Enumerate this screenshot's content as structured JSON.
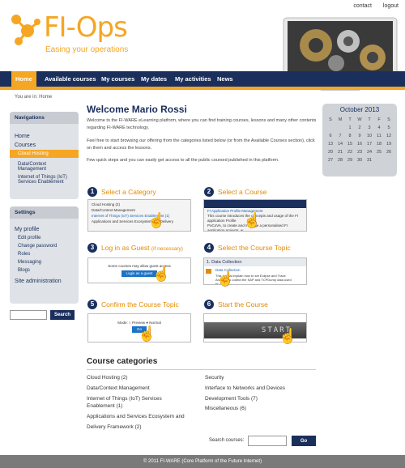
{
  "toplinks": {
    "contact": "contact",
    "logout": "logout"
  },
  "logo": {
    "title": "FI-Ops",
    "subtitle": "Easing your operations"
  },
  "nav": [
    {
      "label": "Home",
      "active": true
    },
    {
      "label": "Available courses"
    },
    {
      "label": "My courses"
    },
    {
      "label": "My dates"
    },
    {
      "label": "My activities"
    },
    {
      "label": "News"
    }
  ],
  "breadcrumb": "You are in: Home",
  "navigations": {
    "title": "Navigations",
    "home": "Home",
    "courses": "Courses",
    "items": [
      "Cloud Hosting",
      "Data/Context Management",
      "Internet of Things (IoT) Services Enablement"
    ]
  },
  "settings": {
    "title": "Settings",
    "my_profile": "My profile",
    "items": [
      "Edit profile",
      "Change password",
      "Roles",
      "Messaging",
      "Blogs"
    ],
    "site_admin": "Site administration"
  },
  "side_search": {
    "button": "Search"
  },
  "welcome": "Welcome Mario Rossi",
  "paragraphs": [
    "Welcome to the FI-WARE eLearning platform, where you can find training courses, lessons and many other contents regarding FI-WARE technology.",
    "Feel free to start browsing our offering from the categories listed below (or from the Available Courses section), click on them and access the lessons.",
    "Few quick steps and you can easily get access to all the public coursed published in this platform."
  ],
  "steps": [
    {
      "num": "1",
      "title": "Select a Category",
      "extra": ""
    },
    {
      "num": "2",
      "title": "Select a Course",
      "extra": ""
    },
    {
      "num": "3",
      "title": "Log in as Guest",
      "extra": "(if necessary)"
    },
    {
      "num": "4",
      "title": "Select the Course Topic",
      "extra": ""
    },
    {
      "num": "5",
      "title": "Confirm the Course Topic",
      "extra": ""
    },
    {
      "num": "6",
      "title": "Start the Course",
      "extra": ""
    }
  ],
  "step_shots": {
    "s1": [
      "Cloud Hosting (2)",
      "Data/Context Management",
      "Internet of Things (IoT) Services Enablement (1)",
      "Applications and Services Ecosystem and Delivery"
    ],
    "s2": [
      "FI Application Profile Management",
      "This course introduces the concepts and usage of the FI application Profile",
      "PoCoVA, to create and manage a personalised FI application projects, w..."
    ],
    "s3": [
      "Some courses may allow guest access",
      "Login as a guest"
    ],
    "s4": [
      "1. Data Collection",
      "Data Collection",
      "This tutorial explain how to set Eclipse and Trace Analysis to collect the SAP and TCPDump data used by Trace..."
    ],
    "s5": [
      "Mode:",
      "Preview",
      "Normal",
      "Go"
    ],
    "s6": [
      "START"
    ]
  },
  "calendar": {
    "month": "October 2013",
    "weekdays": [
      "S",
      "M",
      "T",
      "W",
      "T",
      "F",
      "S"
    ],
    "weeks": [
      [
        "",
        "",
        "1",
        "2",
        "3",
        "4",
        "5"
      ],
      [
        "6",
        "7",
        "8",
        "9",
        "10",
        "11",
        "12"
      ],
      [
        "13",
        "14",
        "15",
        "16",
        "17",
        "18",
        "19"
      ],
      [
        "20",
        "21",
        "22",
        "23",
        "24",
        "25",
        "26"
      ],
      [
        "27",
        "28",
        "29",
        "30",
        "31",
        "",
        ""
      ]
    ]
  },
  "categories": {
    "title": "Course categories",
    "left": [
      "Cloud Hosting (2)",
      "Data/Context Management",
      "Internet of Things (IoT) Services Enablement (1)",
      "Applications and Services Ecosystem and Delivery Framework (2)"
    ],
    "right": [
      "Security",
      "Interface to Networks and Devices",
      "Development Tools (7)",
      "Miscellaneous (6)"
    ]
  },
  "bottom_search": {
    "label": "Search courses:",
    "button": "Go"
  },
  "footer": "© 2011 FI-WARE (Core Platform of the Future Internet)",
  "colors": {
    "navy": "#1a2f5c",
    "orange": "#f5a623"
  }
}
